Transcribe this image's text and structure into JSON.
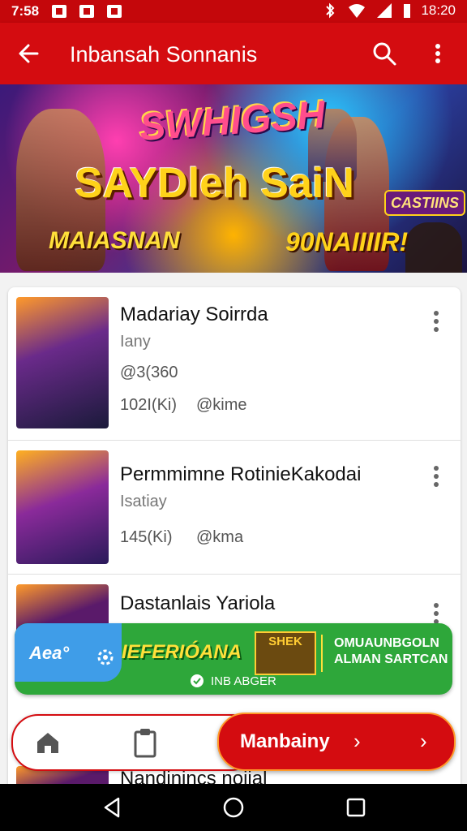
{
  "status": {
    "time": "7:58",
    "clock": "18:20"
  },
  "appbar": {
    "title": "Inbansah Sonnanis"
  },
  "banner": {
    "title": "SWHIGSH",
    "subtitle": "SAYDleh SaiN",
    "left_text": "MAIASNAN",
    "right_text": "90NAIIIIR!",
    "badge": "CASTIINS"
  },
  "list": [
    {
      "name": "Madariay Soirrda",
      "genre": "Iany",
      "rating": "@3(360",
      "size": "102I(Ki)",
      "extra": "@kime"
    },
    {
      "name": "Permmimne RotinieKakodai",
      "genre": "Isatiay",
      "size": "145(Ki)",
      "extra": "@kma"
    },
    {
      "name": "Dastanlais Yariola"
    },
    {
      "name": "Nandinincs noiial"
    }
  ],
  "promo": {
    "logo": "Aea°",
    "brand": "IEFERIÓANA",
    "tile": "SHEK",
    "tag1": "OMUAUNBGOLN",
    "tag2": "ALMAN SARTCAN",
    "footer": "INB ABGER"
  },
  "cta": {
    "label": "Manbainy"
  },
  "colors": {
    "primary": "#d40c10",
    "status": "#c4070b",
    "promo_green": "#2ea73a",
    "promo_blue": "#3f9de8"
  }
}
